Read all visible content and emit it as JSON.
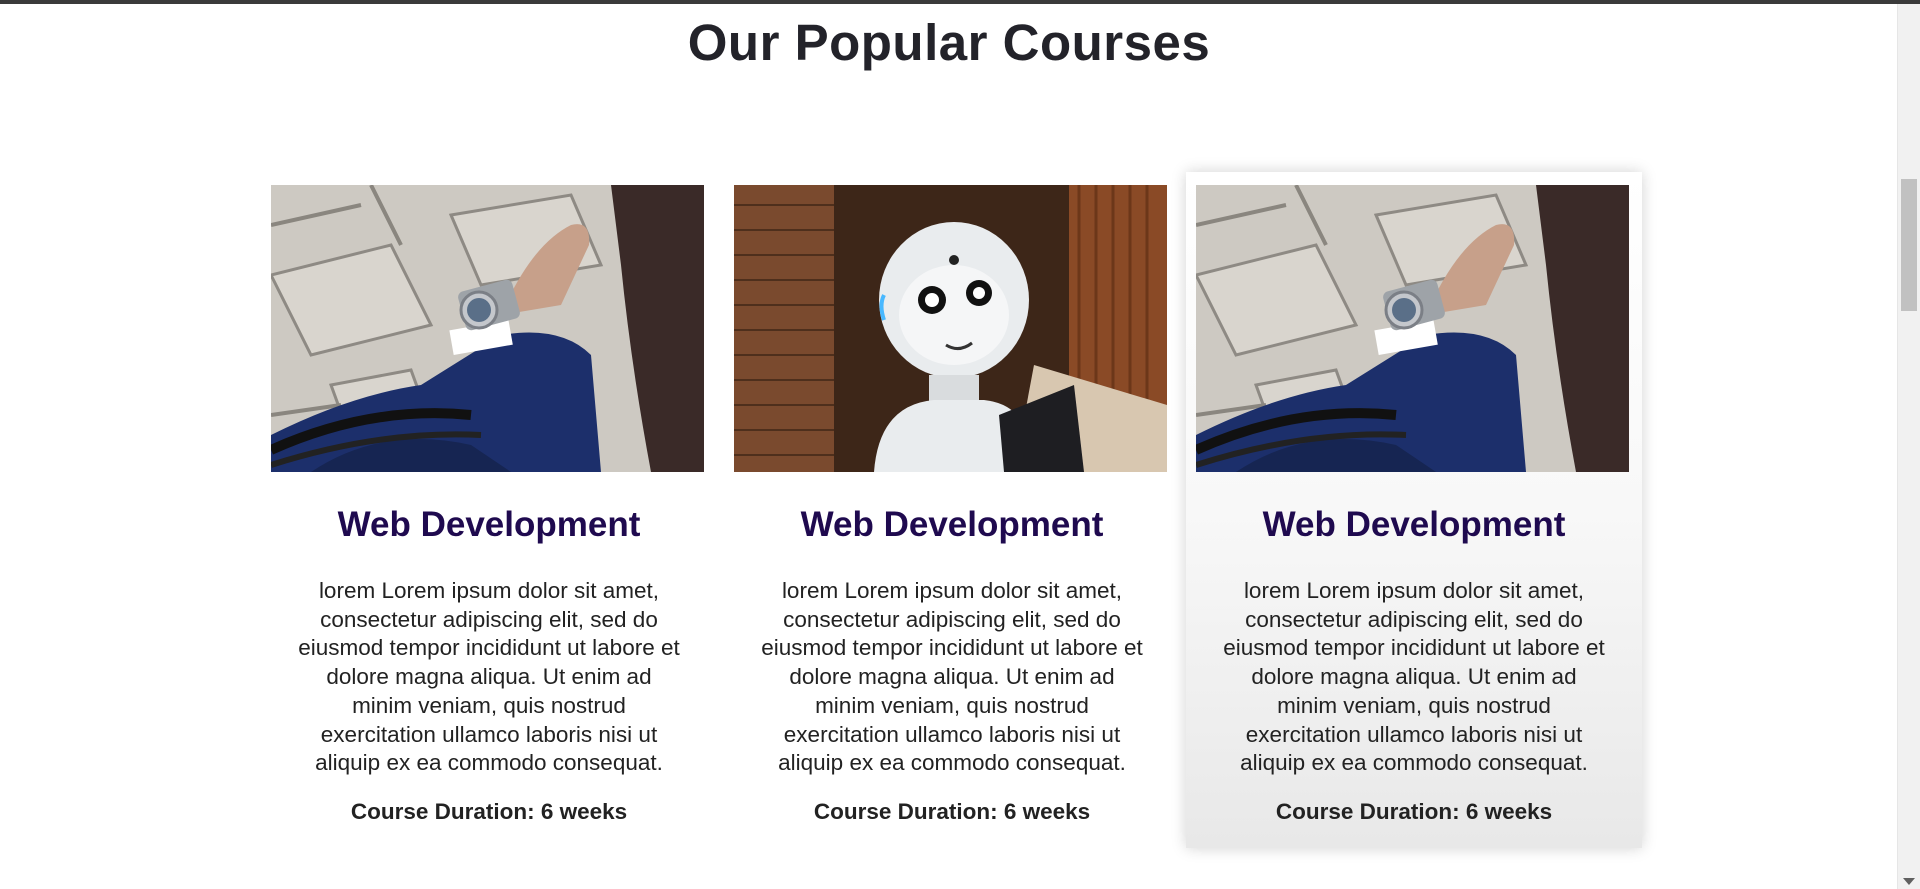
{
  "section": {
    "title": "Our Popular Courses"
  },
  "courses": [
    {
      "title": "Web Development",
      "description": "lorem Lorem ipsum dolor sit amet, consectetur adipiscing elit, sed do eiusmod tempor incididunt ut labore et dolore magna aliqua. Ut enim ad minim veniam, quis nostrud exercitation ullamco laboris nisi ut aliquip ex ea commodo consequat.",
      "duration": "Course Duration: 6 weeks",
      "image": "wristwatch-photo"
    },
    {
      "title": "Web Development",
      "description": "lorem Lorem ipsum dolor sit amet, consectetur adipiscing elit, sed do eiusmod tempor incididunt ut labore et dolore magna aliqua. Ut enim ad minim veniam, quis nostrud exercitation ullamco laboris nisi ut aliquip ex ea commodo consequat.",
      "duration": "Course Duration: 6 weeks",
      "image": "robot-photo"
    },
    {
      "title": "Web Development",
      "description": "lorem Lorem ipsum dolor sit amet, consectetur adipiscing elit, sed do eiusmod tempor incididunt ut labore et dolore magna aliqua. Ut enim ad minim veniam, quis nostrud exercitation ullamco laboris nisi ut aliquip ex ea commodo consequat.",
      "duration": "Course Duration: 6 weeks",
      "image": "wristwatch-photo"
    }
  ],
  "colors": {
    "title_text": "#23232a",
    "card_title": "#1f0a4f",
    "body_text": "#222222",
    "page_background": "#ffffff"
  }
}
